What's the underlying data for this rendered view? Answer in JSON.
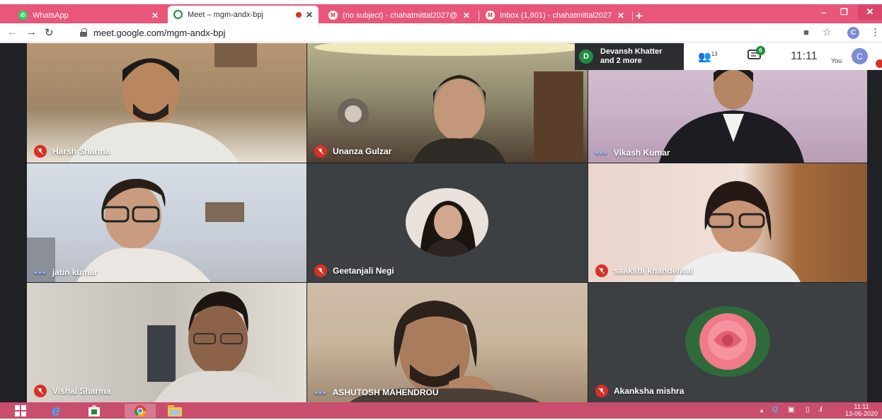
{
  "browser": {
    "tabs": [
      {
        "title": "WhatsApp",
        "favicon": "whatsapp-icon",
        "active": false
      },
      {
        "title": "Meet – mgm-andx-bpj",
        "favicon": "meet-icon",
        "active": true,
        "recording": true
      },
      {
        "title": "(no subject) - chahatmittal2027@",
        "favicon": "gmail-icon",
        "active": false
      },
      {
        "title": "Inbox (1,601) - chahatmittal2027",
        "favicon": "gmail-icon",
        "active": false
      }
    ],
    "new_tab_label": "+",
    "url": "meet.google.com/mgm-andx-bpj",
    "profile_initial": "C",
    "accent_color": "#e8567a"
  },
  "meeting": {
    "presenter_initial": "D",
    "presenter_line1": "Devansh Khatter",
    "presenter_line2": "and 2 more",
    "participant_count": "13",
    "chat_count": "6",
    "time": "11:11",
    "self_label": "You",
    "self_initial": "C",
    "participants": [
      {
        "name": "Harsh Sharma",
        "status": "muted"
      },
      {
        "name": "Unanza Gulzar",
        "status": "muted"
      },
      {
        "name": "Vikash Kumar",
        "status": "speaking"
      },
      {
        "name": "jatin kumar",
        "status": "speaking"
      },
      {
        "name": "Geetanjali Negi",
        "status": "muted"
      },
      {
        "name": "saakshi khandelwal",
        "status": "muted"
      },
      {
        "name": "Vishal Sharma",
        "status": "muted"
      },
      {
        "name": "ASHUTOSH MAHENDROU",
        "status": "speaking"
      },
      {
        "name": "Akanksha mishra",
        "status": "muted"
      }
    ]
  },
  "taskbar": {
    "clock_time": "11:11",
    "clock_date": "13-06-2020",
    "tray_tray_up": "▲",
    "color": "#c94d6d"
  }
}
